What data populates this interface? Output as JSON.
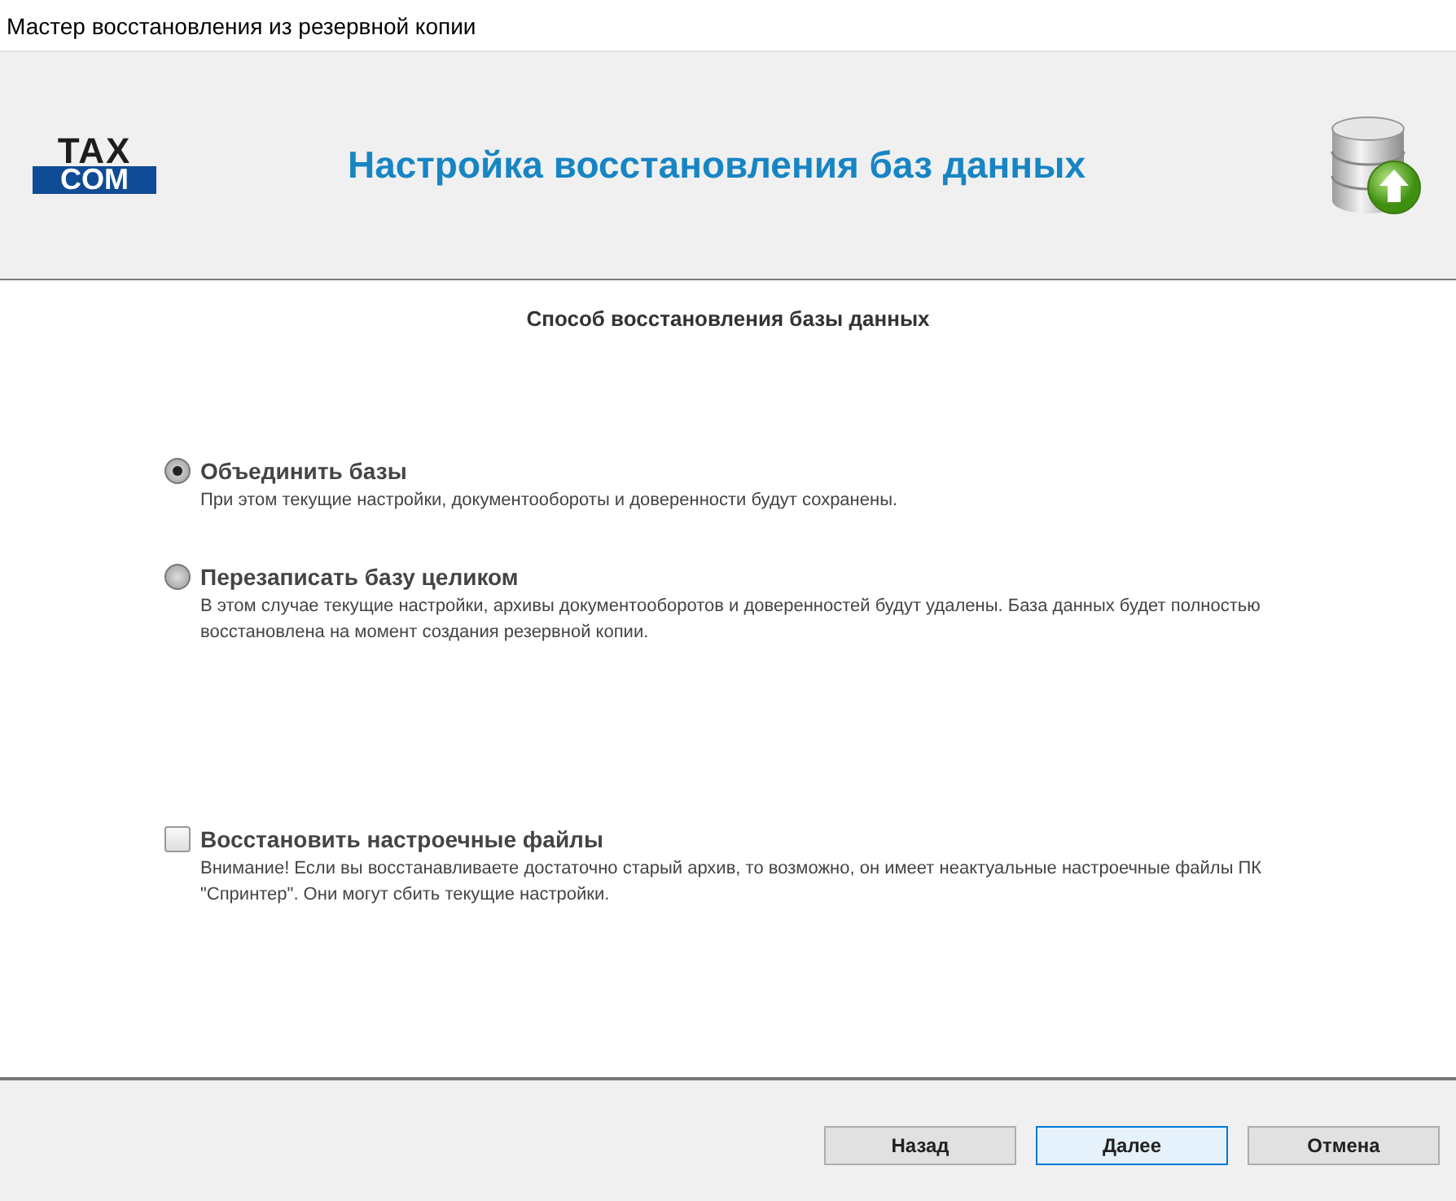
{
  "window": {
    "title": "Мастер восстановления из резервной копии"
  },
  "header": {
    "logo": [
      "TAX",
      "COM"
    ],
    "title": "Настройка восстановления баз данных"
  },
  "section_title": "Способ восстановления базы данных",
  "options": [
    {
      "kind": "radio",
      "label": "Объединить базы",
      "description": "При этом текущие настройки, документообороты и доверенности будут сохранены.",
      "selected": true
    },
    {
      "kind": "radio",
      "label": "Перезаписать базу целиком",
      "description": "В этом случае текущие настройки, архивы документооборотов и доверенностей будут удалены. База данных будет полностью восстановлена на момент создания резервной копии.",
      "selected": false
    },
    {
      "kind": "checkbox",
      "label": "Восстановить настроечные файлы",
      "description": "Внимание! Если вы восстанавливаете достаточно старый архив, то возможно, он имеет неактуальные настроечные файлы ПК \"Спринтер\". Они могут сбить текущие настройки.",
      "checked": false
    }
  ],
  "buttons": [
    {
      "label": "Назад",
      "default": false
    },
    {
      "label": "Далее",
      "default": true
    },
    {
      "label": "Отмена",
      "default": false
    }
  ]
}
